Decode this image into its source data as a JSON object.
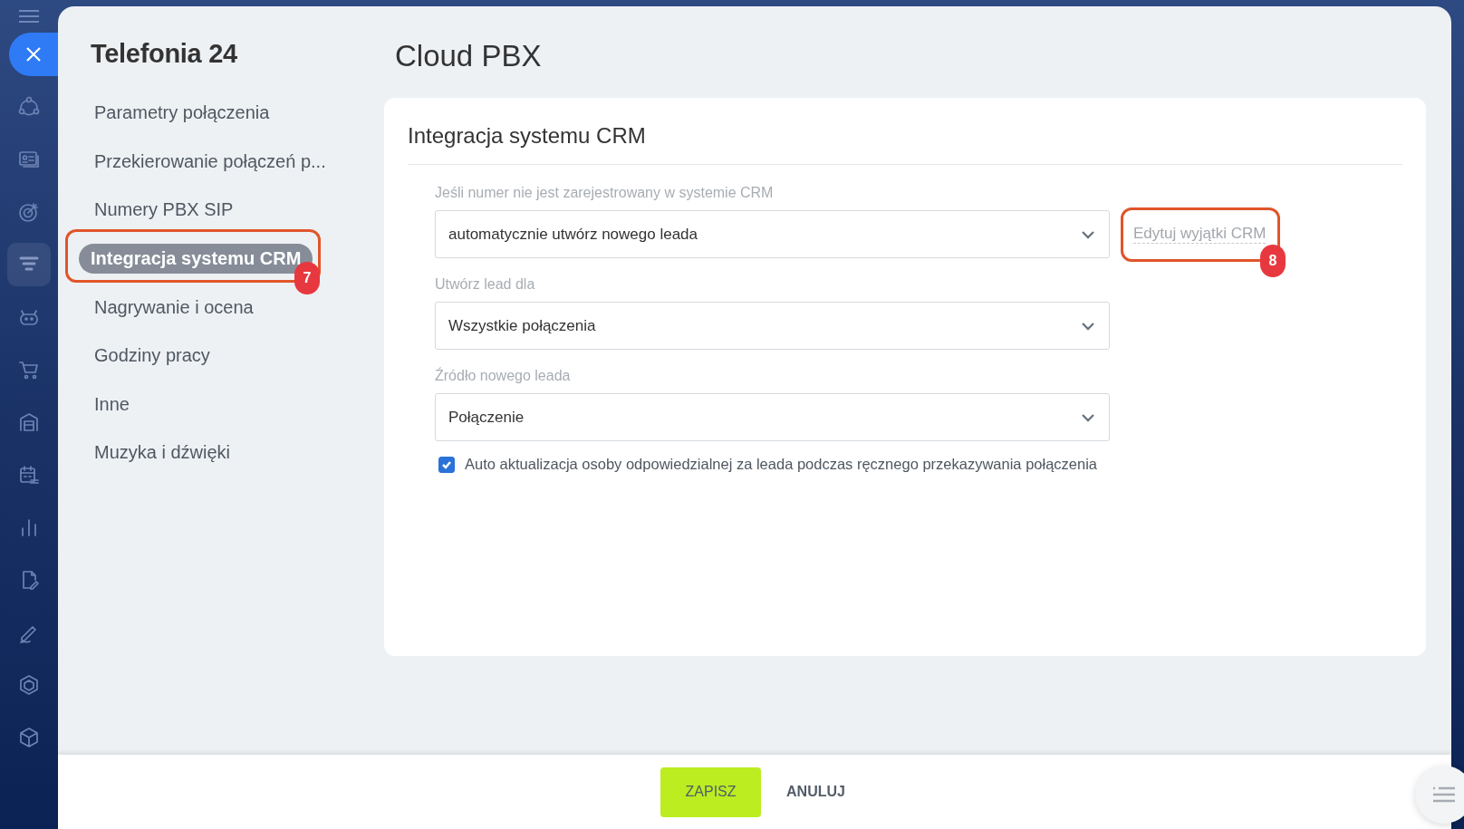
{
  "rail": {
    "items": [
      {
        "kind": "nodes",
        "selected": false
      },
      {
        "kind": "card",
        "selected": false
      },
      {
        "kind": "target",
        "selected": false
      },
      {
        "kind": "funnel",
        "selected": true
      },
      {
        "kind": "robot",
        "selected": false
      },
      {
        "kind": "cart",
        "selected": false
      },
      {
        "kind": "warehouse",
        "selected": false
      },
      {
        "kind": "calendar",
        "selected": false
      },
      {
        "kind": "chart",
        "selected": false
      },
      {
        "kind": "document",
        "selected": false
      },
      {
        "kind": "pen",
        "selected": false
      },
      {
        "kind": "hexagon",
        "selected": false
      },
      {
        "kind": "cube",
        "selected": false
      }
    ]
  },
  "sidebar": {
    "title": "Telefonia 24",
    "items": [
      {
        "label": "Parametry połączenia",
        "selected": false
      },
      {
        "label": "Przekierowanie połączeń p...",
        "selected": false
      },
      {
        "label": "Numery PBX SIP",
        "selected": false
      },
      {
        "label": "Integracja systemu CRM",
        "selected": true,
        "callout": "7"
      },
      {
        "label": "Nagrywanie i ocena",
        "selected": false
      },
      {
        "label": "Godziny pracy",
        "selected": false
      },
      {
        "label": "Inne",
        "selected": false
      },
      {
        "label": "Muzyka i dźwięki",
        "selected": false
      }
    ]
  },
  "page_title": "Cloud PBX",
  "section": {
    "title": "Integracja systemu CRM",
    "fields": [
      {
        "label": "Jeśli numer nie jest zarejestrowany w systemie CRM",
        "value": "automatycznie utwórz nowego leada",
        "link": "Edytuj wyjątki CRM",
        "callout": "8"
      },
      {
        "label": "Utwórz lead dla",
        "value": "Wszystkie połączenia"
      },
      {
        "label": "Źródło nowego leada",
        "value": "Połączenie"
      }
    ],
    "checkbox": {
      "label": "Auto aktualizacja osoby odpowiedzialnej za leada podczas ręcznego przekazywania połączenia",
      "checked": true
    }
  },
  "footer": {
    "save": "ZAPISZ",
    "cancel": "ANULUJ"
  }
}
